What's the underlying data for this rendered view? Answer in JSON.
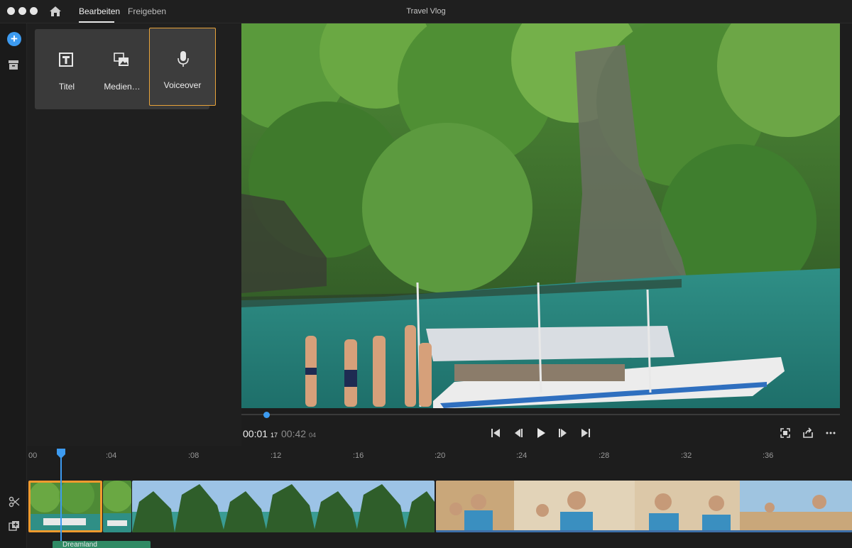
{
  "window": {
    "title": "Travel Vlog"
  },
  "tabs": [
    {
      "label": "Bearbeiten",
      "active": true
    },
    {
      "label": "Freigeben",
      "active": false
    }
  ],
  "rail": {
    "add_label": "+"
  },
  "tiles": [
    {
      "label": "Titel",
      "icon": "title-icon"
    },
    {
      "label": "Medien…",
      "icon": "media-icon"
    },
    {
      "label": "Voiceover",
      "icon": "microphone-icon",
      "selected": true
    }
  ],
  "player": {
    "current": {
      "time": "00:01",
      "frames": "17"
    },
    "total": {
      "time": "00:42",
      "frames": "04"
    },
    "progress": 0.04
  },
  "timeline": {
    "ruler": [
      "00",
      ":04",
      ":08",
      ":12",
      ":16",
      ":20",
      ":24",
      ":28",
      ":32",
      ":36"
    ],
    "audio_label": "Dreamland"
  },
  "colors": {
    "accent": "#3d9bf0",
    "selection": "#f09a2e",
    "audio": "#2f8a64"
  }
}
